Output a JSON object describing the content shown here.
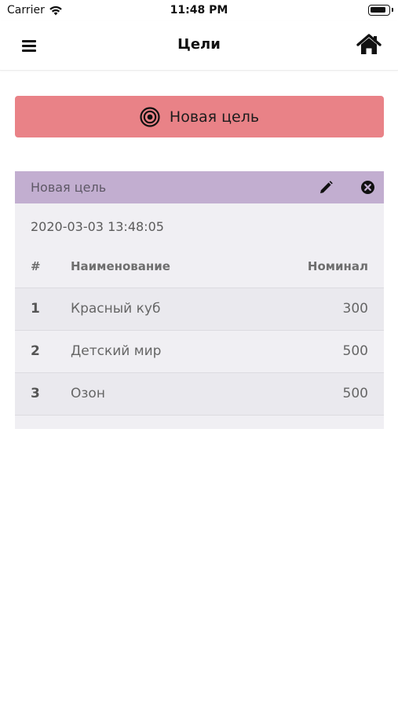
{
  "status_bar": {
    "carrier": "Carrier",
    "time": "11:48 PM"
  },
  "nav": {
    "title": "Цели",
    "menu_icon": "hamburger-menu-icon",
    "home_icon": "home-icon"
  },
  "new_goal_button": {
    "label": "Новая цель",
    "icon": "target-icon",
    "color": "#e98287"
  },
  "goal_card": {
    "title": "Новая цель",
    "header_color": "#c2aed0",
    "date": "2020-03-03 13:48:05",
    "table": {
      "headers": {
        "num": "#",
        "name": "Наименование",
        "value": "Номинал"
      },
      "rows": [
        {
          "num": "1",
          "name": "Красный куб",
          "value": "300"
        },
        {
          "num": "2",
          "name": "Детский мир",
          "value": "500"
        },
        {
          "num": "3",
          "name": "Озон",
          "value": "500"
        }
      ]
    }
  }
}
